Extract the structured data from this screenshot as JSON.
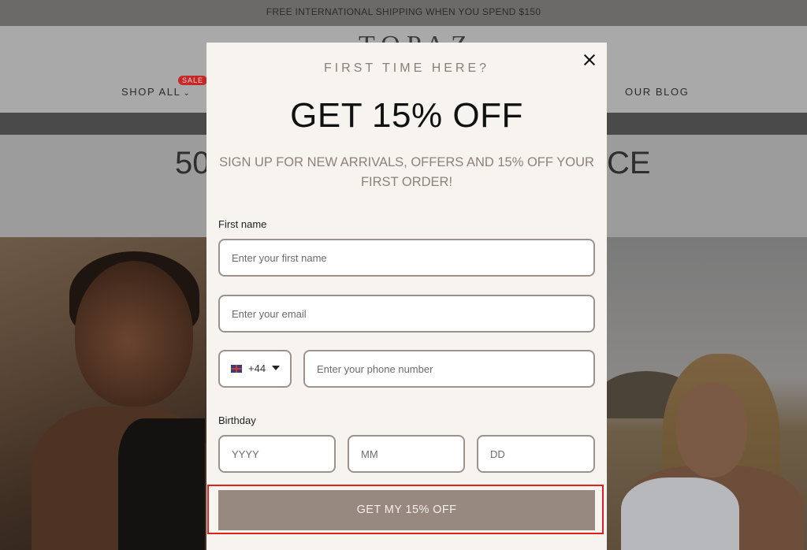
{
  "announcement": "FREE INTERNATIONAL SHIPPING WHEN YOU SPEND $150",
  "header": {
    "logo": "TOPAZ",
    "nav_left": "SHOP ALL",
    "sale_badge": "SALE",
    "nav_right": "OUR BLOG"
  },
  "hero": {
    "left_fragment": "50",
    "right_fragment": "CE"
  },
  "popup": {
    "eyebrow": "FIRST TIME HERE?",
    "headline": "GET 15% OFF",
    "subheadline": "SIGN UP FOR NEW ARRIVALS, OFFERS AND 15% OFF YOUR FIRST ORDER!",
    "first_name_label": "First name",
    "first_name_placeholder": "Enter your first name",
    "email_placeholder": "Enter your email",
    "country_code": "+44",
    "phone_placeholder": "Enter your phone number",
    "birthday_label": "Birthday",
    "year_placeholder": "YYYY",
    "month_placeholder": "MM",
    "day_placeholder": "DD",
    "submit_label": "GET MY 15% OFF"
  },
  "colors": {
    "overlay": "#9a9a9a",
    "modal_bg": "#f7f4f0",
    "button_bg": "#978880",
    "highlight_outline": "#e0201c",
    "sale_badge": "#c62727"
  },
  "icons": [
    "close-icon",
    "uk-flag-icon",
    "caret-down-icon",
    "chevron-down-icon"
  ]
}
